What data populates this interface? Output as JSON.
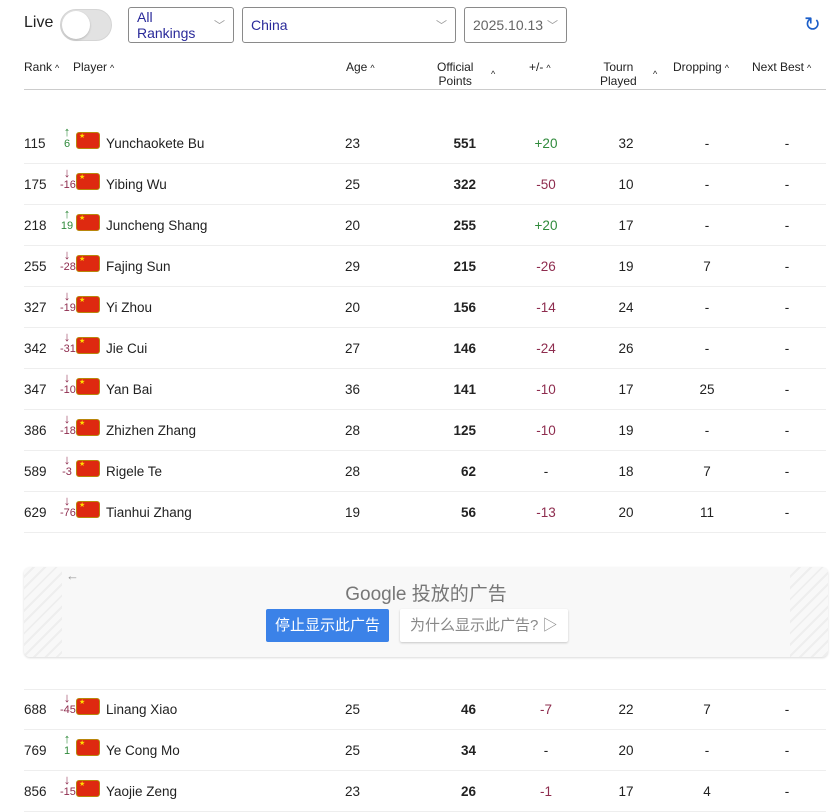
{
  "toolbar": {
    "live_label": "Live",
    "live_on": false,
    "ranking_type": "All Rankings",
    "country": "China",
    "date": "2025.10.13"
  },
  "headers": {
    "rank": "Rank",
    "player": "Player",
    "age": "Age",
    "points_1": "Official",
    "points_2": "Points",
    "diff": "+/-",
    "tourn_1": "Tourn",
    "tourn_2": "Played",
    "dropping": "Dropping",
    "next_best": "Next Best"
  },
  "colors": {
    "up": "#2f8a3b",
    "down": "#8e2c4e",
    "accent": "#1b5ec9"
  },
  "rows": [
    {
      "rank": "115",
      "dir": "up",
      "move": "6",
      "name": "Yunchaokete Bu",
      "age": "23",
      "points": "551",
      "diff": "+20",
      "played": "32",
      "dropping": "-",
      "next": "-"
    },
    {
      "rank": "175",
      "dir": "down",
      "move": "-16",
      "name": "Yibing Wu",
      "age": "25",
      "points": "322",
      "diff": "-50",
      "played": "10",
      "dropping": "-",
      "next": "-"
    },
    {
      "rank": "218",
      "dir": "up",
      "move": "19",
      "name": "Juncheng Shang",
      "age": "20",
      "points": "255",
      "diff": "+20",
      "played": "17",
      "dropping": "-",
      "next": "-"
    },
    {
      "rank": "255",
      "dir": "down",
      "move": "-28",
      "name": "Fajing Sun",
      "age": "29",
      "points": "215",
      "diff": "-26",
      "played": "19",
      "dropping": "7",
      "next": "-"
    },
    {
      "rank": "327",
      "dir": "down",
      "move": "-19",
      "name": "Yi Zhou",
      "age": "20",
      "points": "156",
      "diff": "-14",
      "played": "24",
      "dropping": "-",
      "next": "-"
    },
    {
      "rank": "342",
      "dir": "down",
      "move": "-31",
      "name": "Jie Cui",
      "age": "27",
      "points": "146",
      "diff": "-24",
      "played": "26",
      "dropping": "-",
      "next": "-"
    },
    {
      "rank": "347",
      "dir": "down",
      "move": "-10",
      "name": "Yan Bai",
      "age": "36",
      "points": "141",
      "diff": "-10",
      "played": "17",
      "dropping": "25",
      "next": "-"
    },
    {
      "rank": "386",
      "dir": "down",
      "move": "-18",
      "name": "Zhizhen Zhang",
      "age": "28",
      "points": "125",
      "diff": "-10",
      "played": "19",
      "dropping": "-",
      "next": "-"
    },
    {
      "rank": "589",
      "dir": "down",
      "move": "-3",
      "name": "Rigele Te",
      "age": "28",
      "points": "62",
      "diff": "-",
      "played": "18",
      "dropping": "7",
      "next": "-"
    },
    {
      "rank": "629",
      "dir": "down",
      "move": "-76",
      "name": "Tianhui Zhang",
      "age": "19",
      "points": "56",
      "diff": "-13",
      "played": "20",
      "dropping": "11",
      "next": "-"
    },
    {
      "rank": "688",
      "dir": "down",
      "move": "-45",
      "name": "Linang Xiao",
      "age": "25",
      "points": "46",
      "diff": "-7",
      "played": "22",
      "dropping": "7",
      "next": "-"
    },
    {
      "rank": "769",
      "dir": "up",
      "move": "1",
      "name": "Ye Cong Mo",
      "age": "25",
      "points": "34",
      "diff": "-",
      "played": "20",
      "dropping": "-",
      "next": "-"
    },
    {
      "rank": "856",
      "dir": "down",
      "move": "-15",
      "name": "Yaojie Zeng",
      "age": "23",
      "points": "26",
      "diff": "-1",
      "played": "17",
      "dropping": "4",
      "next": "-"
    }
  ],
  "ad": {
    "title": "Google 投放的广告",
    "stop_label": "停止显示此广告",
    "why_label": "为什么显示此广告?"
  }
}
